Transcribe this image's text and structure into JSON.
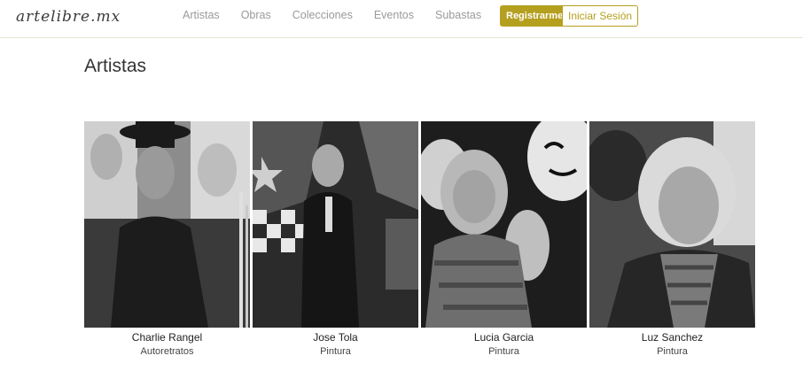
{
  "brand": {
    "logo_text": "artelibre.mx"
  },
  "nav": {
    "links": [
      "Artistas",
      "Obras",
      "Colecciones",
      "Eventos",
      "Subastas"
    ],
    "register_label": "Registrarme",
    "login_label": "Iniciar Sesión"
  },
  "page": {
    "title": "Artistas"
  },
  "artists": [
    {
      "name": "Charlie Rangel",
      "category": "Autoretratos"
    },
    {
      "name": "Jose Tola",
      "category": "Pintura"
    },
    {
      "name": "Lucia Garcia",
      "category": "Pintura"
    },
    {
      "name": "Luz Sanchez",
      "category": "Pintura"
    }
  ],
  "colors": {
    "accent": "#b59f1f",
    "nav_link": "#9a9a9a",
    "title": "#333333"
  }
}
